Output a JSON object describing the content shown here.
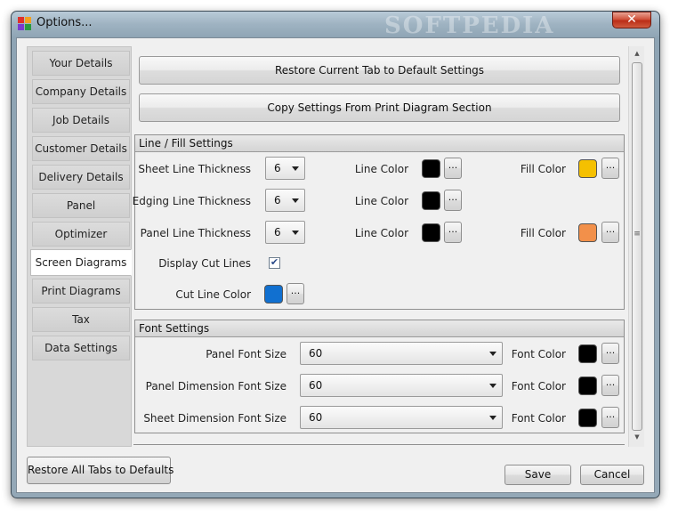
{
  "window": {
    "title": "Options...",
    "watermark": "SOFTPEDIA",
    "close_glyph": "✕"
  },
  "sidebar": {
    "items": [
      {
        "label": "Your Details"
      },
      {
        "label": "Company Details"
      },
      {
        "label": "Job Details"
      },
      {
        "label": "Customer Details"
      },
      {
        "label": "Delivery Details"
      },
      {
        "label": "Panel"
      },
      {
        "label": "Optimizer"
      },
      {
        "label": "Screen Diagrams",
        "selected": true
      },
      {
        "label": "Print Diagrams"
      },
      {
        "label": "Tax"
      },
      {
        "label": "Data Settings"
      }
    ]
  },
  "actions": {
    "restore_tab": "Restore Current Tab to Default Settings",
    "copy_print": "Copy Settings From Print Diagram Section"
  },
  "line_fill": {
    "title": "Line / Fill Settings",
    "rows": [
      {
        "label": "Sheet Line Thickness",
        "value": "6",
        "line_color_label": "Line Color",
        "line_color": "#000000",
        "fill_color_label": "Fill Color",
        "fill_color": "#f5c000"
      },
      {
        "label": "Edging Line Thickness",
        "value": "6",
        "line_color_label": "Line Color",
        "line_color": "#000000"
      },
      {
        "label": "Panel Line Thickness",
        "value": "6",
        "line_color_label": "Line Color",
        "line_color": "#000000",
        "fill_color_label": "Fill Color",
        "fill_color": "#f2904a"
      }
    ],
    "display_cut_lines_label": "Display Cut Lines",
    "display_cut_lines_checked": true,
    "cut_line_color_label": "Cut Line Color",
    "cut_line_color": "#1170d0",
    "ellipsis": "..."
  },
  "font_settings": {
    "title": "Font Settings",
    "rows": [
      {
        "label": "Panel Font Size",
        "value": "60",
        "color_label": "Font Color",
        "color": "#000000"
      },
      {
        "label": "Panel Dimension Font Size",
        "value": "60",
        "color_label": "Font Color",
        "color": "#000000"
      },
      {
        "label": "Sheet Dimension Font Size",
        "value": "60",
        "color_label": "Font Color",
        "color": "#000000"
      }
    ]
  },
  "footer": {
    "restore_all": "Restore All Tabs to Defaults",
    "save": "Save",
    "cancel": "Cancel"
  },
  "colors": {
    "sidebar_bg": "#d8d8d8",
    "client_bg": "#f0f0f0",
    "close_button": "#c8402a"
  }
}
